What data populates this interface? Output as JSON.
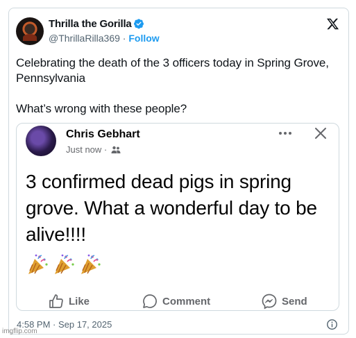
{
  "tweet": {
    "display_name": "Thrilla the Gorilla",
    "handle": "@ThrillaRilla369",
    "separator": " · ",
    "follow_label": "Follow",
    "text": "Celebrating the death of the 3 officers today in Spring Grove, Pennsylvania\n\nWhat’s wrong with these people?",
    "timestamp": "4:58 PM · Sep 17, 2025",
    "verified_color": "#1d9bf0",
    "icons": [
      "verified-icon",
      "x-logo-icon",
      "info-icon"
    ]
  },
  "quoted_post": {
    "author": "Chris Gebhart",
    "time": "Just now · ",
    "body": "3 confirmed dead pigs in spring grove.  What a wonderful day to be alive!!!!",
    "emoji": [
      "party-popper",
      "party-popper",
      "party-popper"
    ],
    "actions": [
      {
        "label": "Like",
        "icon": "thumbs-up-icon"
      },
      {
        "label": "Comment",
        "icon": "comment-icon"
      },
      {
        "label": "Send",
        "icon": "messenger-icon"
      }
    ]
  },
  "watermark": "imgflip.com"
}
